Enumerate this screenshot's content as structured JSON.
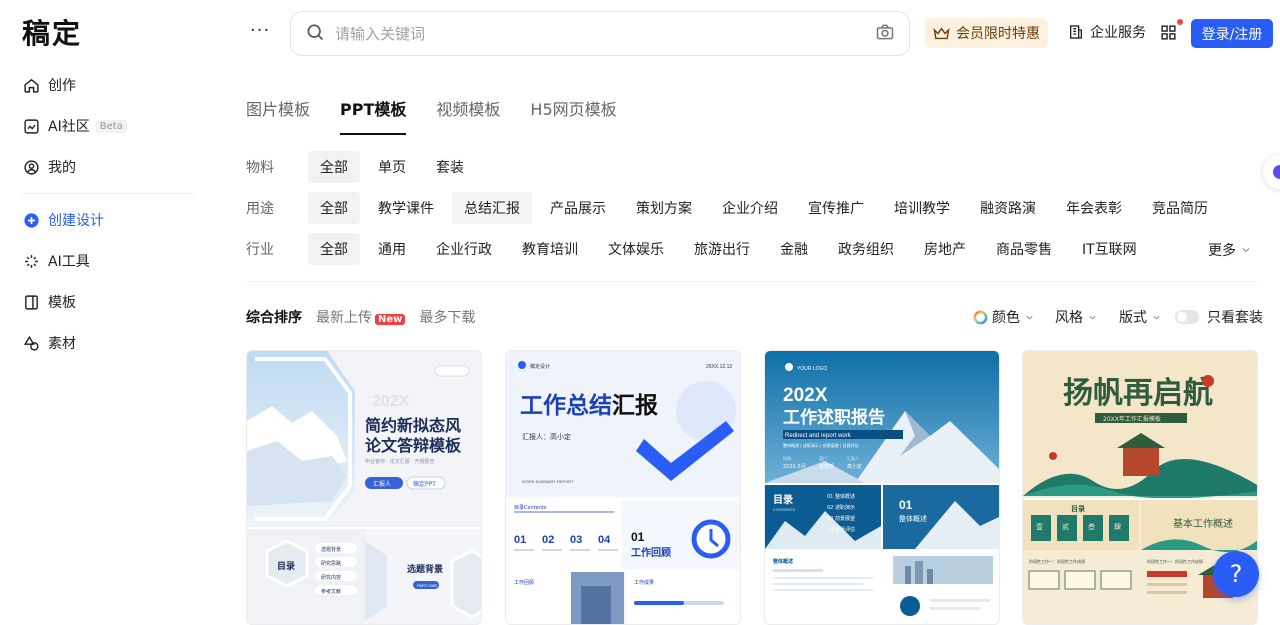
{
  "brand": {
    "logo": "稿定"
  },
  "sidebar": {
    "items": [
      {
        "label": "创作",
        "icon": "home-icon"
      },
      {
        "label": "AI社区",
        "icon": "ai-community-icon",
        "badge": "Beta"
      },
      {
        "label": "我的",
        "icon": "user-icon"
      },
      {
        "label": "创建设计",
        "icon": "plus-circle-icon",
        "active": true
      },
      {
        "label": "AI工具",
        "icon": "sparkle-icon"
      },
      {
        "label": "模板",
        "icon": "template-icon"
      },
      {
        "label": "素材",
        "icon": "shapes-icon"
      }
    ]
  },
  "topbar": {
    "more": "···",
    "search_placeholder": "请输入关键词",
    "vip_label": "会员限时特惠",
    "biz_label": "企业服务",
    "login_label": "登录/注册"
  },
  "tabs": [
    {
      "label": "图片模板",
      "active": false
    },
    {
      "label": "PPT模板",
      "active": true
    },
    {
      "label": "视频模板",
      "active": false
    },
    {
      "label": "H5网页模板",
      "active": false
    }
  ],
  "filters": {
    "material": {
      "label": "物料",
      "options": [
        "全部",
        "单页",
        "套装"
      ],
      "selected": "全部"
    },
    "usage": {
      "label": "用途",
      "options": [
        "全部",
        "教学课件",
        "总结汇报",
        "产品展示",
        "策划方案",
        "企业介绍",
        "宣传推广",
        "培训教学",
        "融资路演",
        "年会表彰",
        "竞品简历"
      ],
      "selected": "全部",
      "highlighted": "总结汇报"
    },
    "industry": {
      "label": "行业",
      "options": [
        "全部",
        "通用",
        "企业行政",
        "教育培训",
        "文体娱乐",
        "旅游出行",
        "金融",
        "政务组织",
        "房地产",
        "商品零售",
        "IT互联网"
      ],
      "selected": "全部"
    },
    "more_label": "更多"
  },
  "sort": {
    "options": [
      "综合排序",
      "最新上传",
      "最多下载"
    ],
    "active": "综合排序",
    "new_badge": "New",
    "color_label": "颜色",
    "style_label": "风格",
    "layout_label": "版式",
    "set_only_label": "只看套装"
  },
  "cards": [
    {
      "title_line1": "简约新拟态风",
      "title_line2": "论文答辩模板",
      "ghost": "202X",
      "sub": "毕业答辩 · 论文汇报 · 开题报告",
      "btn1": "汇报人",
      "btn2": "稿定PPT",
      "toc": "目录",
      "items": [
        "选题背景",
        "研究思路",
        "研究内容",
        "参考文献"
      ],
      "section": "选题背景",
      "section_sub": "PART ONE"
    },
    {
      "brand": "稿定设计",
      "date": "20XX.12.12",
      "title_a": "工作总结",
      "title_b": "汇报",
      "reporter": "汇报人：高小定",
      "en": "WORK SUMMARY REPORT",
      "contents": "目录Contents",
      "nums": [
        "01",
        "02",
        "03",
        "04"
      ],
      "part_num": "01",
      "part_title": "工作回顾",
      "bottom_left": "工作回顾",
      "bottom_right": "工作成果"
    },
    {
      "logo": "YOUR LOGO",
      "title_a": "202X",
      "title_b": "工作述职报告",
      "en": "Redirect and report work",
      "desc": "整体概述 | 述职演示 | 前景展望 | 自我评估",
      "date_label": "时间",
      "date_val": "202X.5月",
      "dept_label": "部门",
      "dept_val": "运营部",
      "person_label": "汇报人",
      "person_val": "高小定",
      "toc": "目录",
      "toc_en": "CONTENTS",
      "toc_items": [
        "01 整体概述",
        "02 述职演示",
        "03 前景展望",
        "04 自我评估"
      ],
      "part_num": "01",
      "part_title": "整体概述",
      "bottom_label": "整体概述"
    },
    {
      "title": "扬帆再启航",
      "sub": "20XX年工作汇报模板",
      "toc": "目录",
      "boxes": [
        "壹",
        "贰",
        "叁",
        "肆"
      ],
      "section": "基本工作概述",
      "bottom_left": "阶段性工作一：阶段性工作成绩",
      "bottom_right": "阶段性工作一：阶段性工作成绩"
    }
  ],
  "help_label": "?"
}
